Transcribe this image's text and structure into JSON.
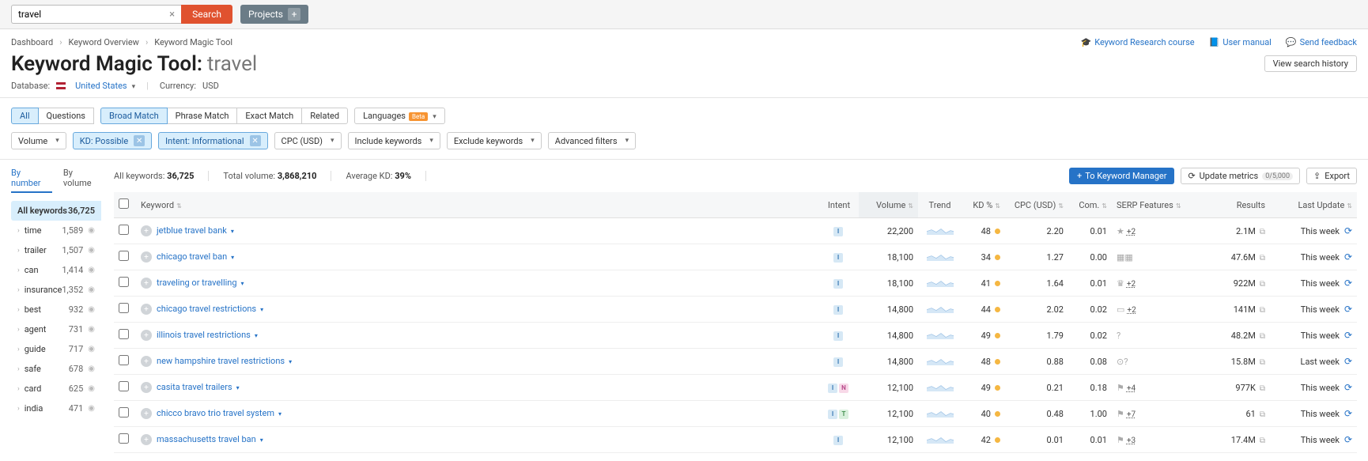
{
  "search": {
    "value": "travel",
    "button": "Search",
    "projects": "Projects"
  },
  "breadcrumbs": {
    "a": "Dashboard",
    "b": "Keyword Overview",
    "c": "Keyword Magic Tool"
  },
  "headerLinks": {
    "course": "Keyword Research course",
    "manual": "User manual",
    "feedback": "Send feedback"
  },
  "title": {
    "name": "Keyword Magic Tool:",
    "term": "travel"
  },
  "viewHistory": "View search history",
  "meta": {
    "dbLabel": "Database:",
    "dbVal": "United States",
    "curLabel": "Currency:",
    "curVal": "USD"
  },
  "matchTabs": {
    "all": "All",
    "questions": "Questions",
    "broad": "Broad Match",
    "phrase": "Phrase Match",
    "exact": "Exact Match",
    "related": "Related",
    "lang": "Languages",
    "beta": "Beta"
  },
  "pills": {
    "volume": "Volume",
    "kd": "KD: Possible",
    "intent": "Intent: Informational",
    "cpc": "CPC (USD)",
    "inc": "Include keywords",
    "exc": "Exclude keywords",
    "adv": "Advanced filters"
  },
  "sideTabs": {
    "num": "By number",
    "vol": "By volume"
  },
  "sideHead": {
    "label": "All keywords",
    "count": "36,725"
  },
  "sideItems": [
    {
      "nm": "time",
      "ct": "1,589"
    },
    {
      "nm": "trailer",
      "ct": "1,507"
    },
    {
      "nm": "can",
      "ct": "1,414"
    },
    {
      "nm": "insurance",
      "ct": "1,352"
    },
    {
      "nm": "best",
      "ct": "932"
    },
    {
      "nm": "agent",
      "ct": "731"
    },
    {
      "nm": "guide",
      "ct": "717"
    },
    {
      "nm": "safe",
      "ct": "678"
    },
    {
      "nm": "card",
      "ct": "625"
    },
    {
      "nm": "india",
      "ct": "471"
    }
  ],
  "stats": {
    "allKwL": "All keywords:",
    "allKwV": "36,725",
    "totVolL": "Total volume:",
    "totVolV": "3,868,210",
    "avgKdL": "Average KD:",
    "avgKdV": "39%"
  },
  "actions": {
    "toKm": "To Keyword Manager",
    "upd": "Update metrics",
    "updCap": "0/5,000",
    "exp": "Export"
  },
  "cols": {
    "kw": "Keyword",
    "intent": "Intent",
    "vol": "Volume",
    "trend": "Trend",
    "kd": "KD %",
    "cpc": "CPC (USD)",
    "com": "Com.",
    "serp": "SERP Features",
    "res": "Results",
    "upd": "Last Update"
  },
  "rows": [
    {
      "kw": "jetblue travel bank",
      "intent": [
        "I"
      ],
      "vol": "22,200",
      "kd": "48",
      "cpc": "2.20",
      "com": "0.01",
      "serpIco": "★",
      "serpN": "+2",
      "res": "2.1M",
      "upd": "This week"
    },
    {
      "kw": "chicago travel ban",
      "intent": [
        "I"
      ],
      "vol": "18,100",
      "kd": "34",
      "cpc": "1.27",
      "com": "0.00",
      "serpIco": "▦▦",
      "serpN": "",
      "res": "47.6M",
      "upd": "This week"
    },
    {
      "kw": "traveling or travelling",
      "intent": [
        "I"
      ],
      "vol": "18,100",
      "kd": "41",
      "cpc": "1.64",
      "com": "0.01",
      "serpIco": "♛",
      "serpN": "+2",
      "res": "922M",
      "upd": "This week"
    },
    {
      "kw": "chicago travel restrictions",
      "intent": [
        "I"
      ],
      "vol": "14,800",
      "kd": "44",
      "cpc": "2.02",
      "com": "0.02",
      "serpIco": "▭",
      "serpN": "+2",
      "res": "141M",
      "upd": "This week"
    },
    {
      "kw": "illinois travel restrictions",
      "intent": [
        "I"
      ],
      "vol": "14,800",
      "kd": "49",
      "cpc": "1.79",
      "com": "0.02",
      "serpIco": "?",
      "serpN": "",
      "res": "48.2M",
      "upd": "This week"
    },
    {
      "kw": "new hampshire travel restrictions",
      "intent": [
        "I"
      ],
      "vol": "14,800",
      "kd": "48",
      "cpc": "0.88",
      "com": "0.08",
      "serpIco": "⊙?",
      "serpN": "",
      "res": "15.8M",
      "upd": "Last week"
    },
    {
      "kw": "casita travel trailers",
      "intent": [
        "I",
        "N"
      ],
      "vol": "12,100",
      "kd": "49",
      "cpc": "0.21",
      "com": "0.18",
      "serpIco": "⚑",
      "serpN": "+4",
      "res": "977K",
      "upd": "This week"
    },
    {
      "kw": "chicco bravo trio travel system",
      "intent": [
        "I",
        "T"
      ],
      "vol": "12,100",
      "kd": "40",
      "cpc": "0.48",
      "com": "1.00",
      "serpIco": "⚑",
      "serpN": "+7",
      "res": "61",
      "upd": "This week"
    },
    {
      "kw": "massachusetts travel ban",
      "intent": [
        "I"
      ],
      "vol": "12,100",
      "kd": "42",
      "cpc": "0.01",
      "com": "0.01",
      "serpIco": "⚑",
      "serpN": "+3",
      "res": "17.4M",
      "upd": "This week"
    }
  ]
}
